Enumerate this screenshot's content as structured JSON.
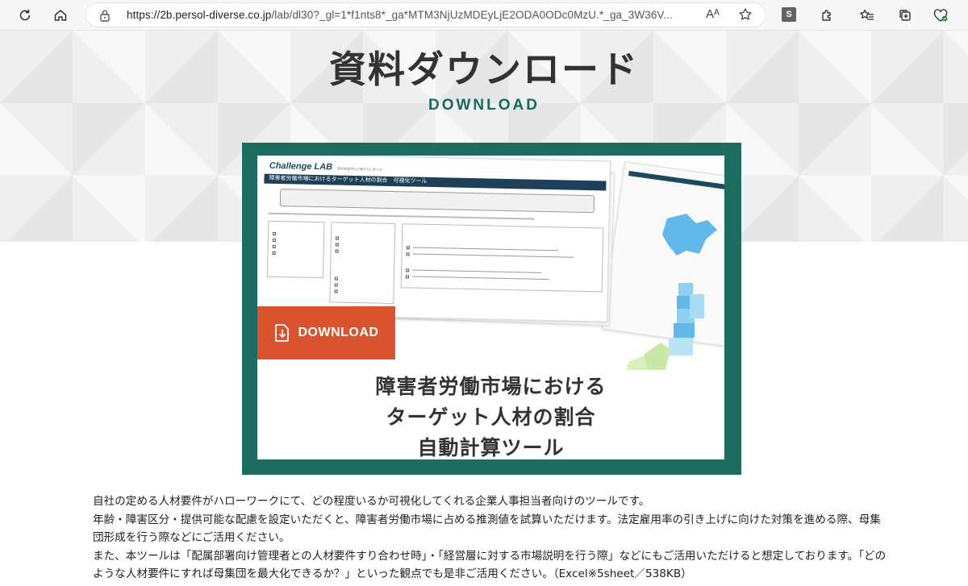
{
  "browser": {
    "url_host": "https://2b.persol-diverse.co.jp",
    "url_path": "/lab/dl30?_gl=1*f1nts8*_ga*MTM3NjUzMDEyLjE2ODA0ODc0MzU.*_ga_3W36V...",
    "read_aloud_label": "Aᴬ",
    "extension_label": "S"
  },
  "page": {
    "title": "資料ダウンロード",
    "subtitle": "DOWNLOAD"
  },
  "hero": {
    "download_label": "DOWNLOAD",
    "caption_line1": "障害者労働市場における",
    "caption_line2": "ターゲット人材の割合",
    "caption_line3": "自動計算ツール",
    "doc_logo": "Challenge LAB",
    "doc_logo_sub": "障害者雇用を企業の力に変える",
    "doc_header": "障害者労働市場におけるターゲット人材の割合　可視化ツール"
  },
  "description": {
    "line1": "自社の定める人材要件がハローワークにて、どの程度いるか可視化してくれる企業人事担当者向けのツールです。",
    "line2": "年齢・障害区分・提供可能な配慮を設定いただくと、障害者労働市場に占める推測値を試算いただけます。法定雇用率の引き上げに向けた対策を進める際、母集団形成を行う際などにご活用ください。",
    "line3": "また、本ツールは「配属部署向け管理者との人材要件すり合わせ時」・「経営層に対する市場説明を行う際」などにもご活用いただけると想定しております。「どのような人材要件にすれば母集団を最大化できるか？」といった観点でも是非ご活用ください。（Excel※5sheet／538KB）"
  },
  "colors": {
    "accent": "#176a5e",
    "hero_frame": "#1e6b5f",
    "download_badge": "#d9532f",
    "doc_header": "#1d3f58"
  }
}
